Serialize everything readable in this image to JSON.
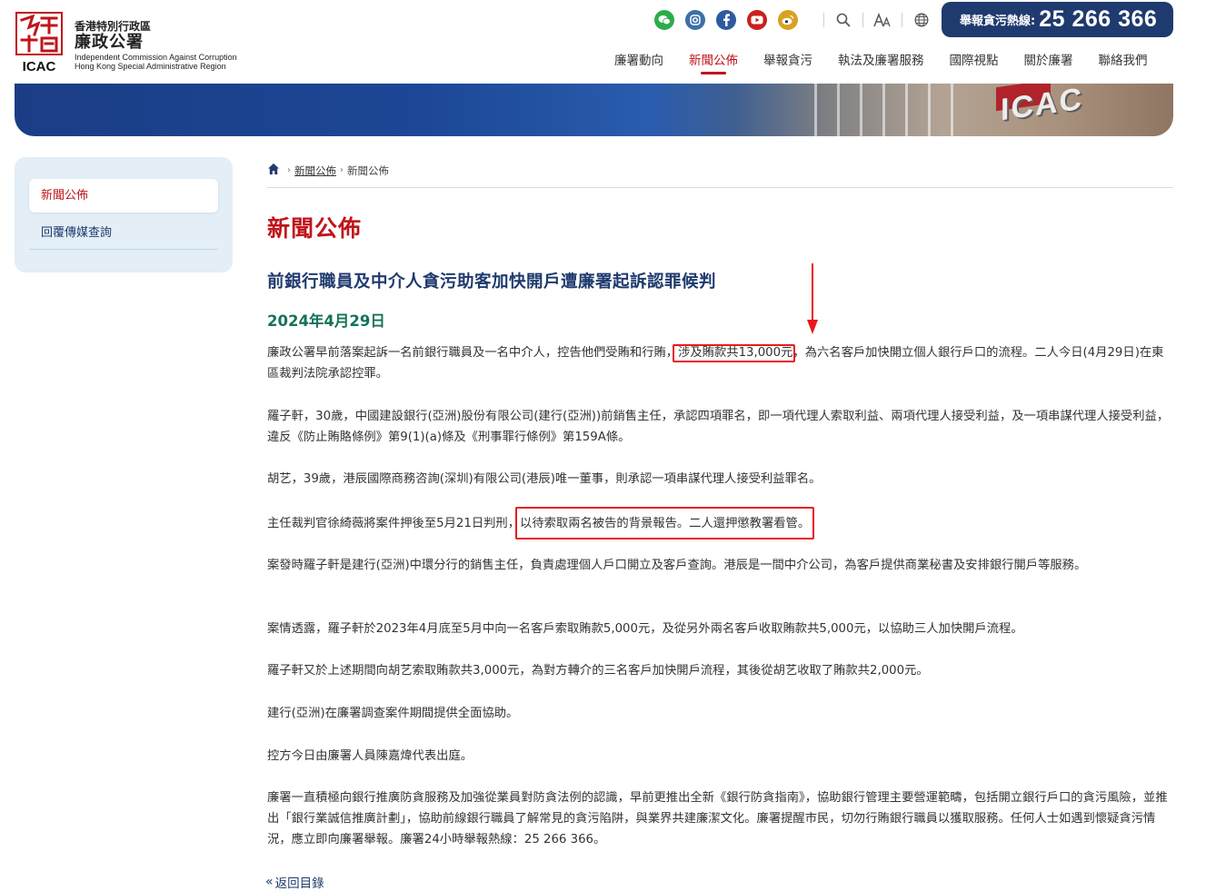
{
  "header": {
    "logo": {
      "zh_small": "香港特別行政區",
      "zh_big": "廉政公署",
      "en_line1": "Independent Commission Against Corruption",
      "en_line2": "Hong Kong Special Administrative Region",
      "mark_text": "ICAC"
    },
    "social": [
      {
        "name": "wechat-icon",
        "color": "#2bad4a",
        "glyph": "✆"
      },
      {
        "name": "instagram-icon",
        "color": "#3d6fa6",
        "glyph": "◎"
      },
      {
        "name": "facebook-icon",
        "color": "#2d5aa0",
        "glyph": "f"
      },
      {
        "name": "youtube-icon",
        "color": "#c8201c",
        "glyph": "▶"
      },
      {
        "name": "weibo-icon",
        "color": "#d9a122",
        "glyph": "微"
      }
    ],
    "tools": [
      "search-icon",
      "font-size-icon",
      "language-globe-icon"
    ],
    "hotline": {
      "label": "舉報貪污熱線:",
      "number": "25 266 366"
    },
    "nav": [
      {
        "label": "廉署動向",
        "active": false
      },
      {
        "label": "新聞公佈",
        "active": true
      },
      {
        "label": "舉報貪污",
        "active": false
      },
      {
        "label": "執法及廉署服務",
        "active": false
      },
      {
        "label": "國際視點",
        "active": false
      },
      {
        "label": "關於廉署",
        "active": false
      },
      {
        "label": "聯絡我們",
        "active": false
      }
    ]
  },
  "sidebar": {
    "items": [
      {
        "label": "新聞公佈",
        "active": true
      },
      {
        "label": "回覆傳媒查詢",
        "active": false
      }
    ]
  },
  "breadcrumb": {
    "items": [
      "新聞公佈",
      "新聞公佈"
    ]
  },
  "page": {
    "title": "新聞公佈",
    "article_title": "前銀行職員及中介人貪污助客加快開戶遭廉署起訴認罪候判",
    "date": "2024年4月29日"
  },
  "paragraphs": {
    "p1_a": "廉政公署早前落案起訴一名前銀行職員及一名中介人，控告他們受賄和行賄，",
    "p1_hl": "涉及賄款共13,000元",
    "p1_b": "，為六名客戶加快開立個人銀行戶口的流程。二人今日(4月29日)在東區裁判法院承認控罪。",
    "p2": "羅子軒，30歲，中國建設銀行(亞洲)股份有限公司(建行(亞洲))前銷售主任，承認四項罪名，即一項代理人索取利益、兩項代理人接受利益，及一項串謀代理人接受利益，違反《防止賄賂條例》第9(1)(a)條及《刑事罪行條例》第159A條。",
    "p3": "胡艺，39歲，港辰國際商務咨詢(深圳)有限公司(港辰)唯一董事，則承認一項串謀代理人接受利益罪名。",
    "p4_a": "主任裁判官徐綺薇將案件押後至5月21日判刑，",
    "p4_hl": "以待索取兩名被告的背景報告。二人還押懲教署看管。",
    "p5": "案發時羅子軒是建行(亞洲)中環分行的銷售主任，負責處理個人戶口開立及客戶查詢。港辰是一間中介公司，為客戶提供商業秘書及安排銀行開戶等服務。",
    "p6": "案情透露，羅子軒於2023年4月底至5月中向一名客戶索取賄款5,000元，及從另外兩名客戶收取賄款共5,000元，以協助三人加快開戶流程。",
    "p7": "羅子軒又於上述期間向胡艺索取賄款共3,000元，為對方轉介的三名客戶加快開戶流程，其後從胡艺收取了賄款共2,000元。",
    "p8": "建行(亞洲)在廉署調查案件期間提供全面協助。",
    "p9": "控方今日由廉署人員陳嘉煒代表出庭。",
    "p10": "廉署一直積極向銀行推廣防貪服務及加強從業員對防貪法例的認識，早前更推出全新《銀行防貪指南》，協助銀行管理主要營運範疇，包括開立銀行戶口的貪污風險，並推出「銀行業誠信推廣計劃」，協助前線銀行職員了解常見的貪污陷阱，與業界共建廉潔文化。廉署提醒市民，切勿行賄銀行職員以獲取服務。任何人士如遇到懷疑貪污情況，應立即向廉署舉報。廉署24小時舉報熱線：25 266 366。"
  },
  "back_link": "返回目錄",
  "colors": {
    "brand_red": "#c0141b",
    "navy": "#1f3a6e",
    "date_green": "#16725a",
    "highlight_red": "#e8181e",
    "sidebar_bg": "#e3eef6"
  }
}
